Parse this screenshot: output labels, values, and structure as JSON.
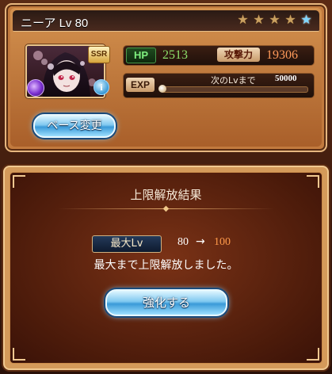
{
  "character": {
    "title": "ニーア Lv 80",
    "rarity_badge": "SSR",
    "element_icon": "dark-element-icon",
    "info_icon_glyph": "i",
    "stars": [
      {
        "glyph": "★",
        "kind": "gold"
      },
      {
        "glyph": "★",
        "kind": "gold"
      },
      {
        "glyph": "★",
        "kind": "gold"
      },
      {
        "glyph": "★",
        "kind": "gold"
      },
      {
        "glyph": "★",
        "kind": "blue"
      }
    ],
    "stats": {
      "hp_label": "HP",
      "hp_value": "2513",
      "atk_label": "攻撃力",
      "atk_value": "19306",
      "exp_label": "EXP",
      "next_label": "次のLvまで",
      "next_value": "50000",
      "exp_progress": 0.0
    },
    "base_change_button": "ベース変更"
  },
  "result": {
    "title": "上限解放結果",
    "max_lv_label": "最大Lv",
    "lv_from": "80",
    "arrow": "→",
    "lv_to": "100",
    "message": "最大まで上限解放しました。",
    "enhance_button": "強化する"
  },
  "colors": {
    "hp_value": "#8ee06a",
    "atk_value": "#ff9a5a",
    "lv_to": "#ff9a4a",
    "button_blue": "#3a9ad8"
  }
}
